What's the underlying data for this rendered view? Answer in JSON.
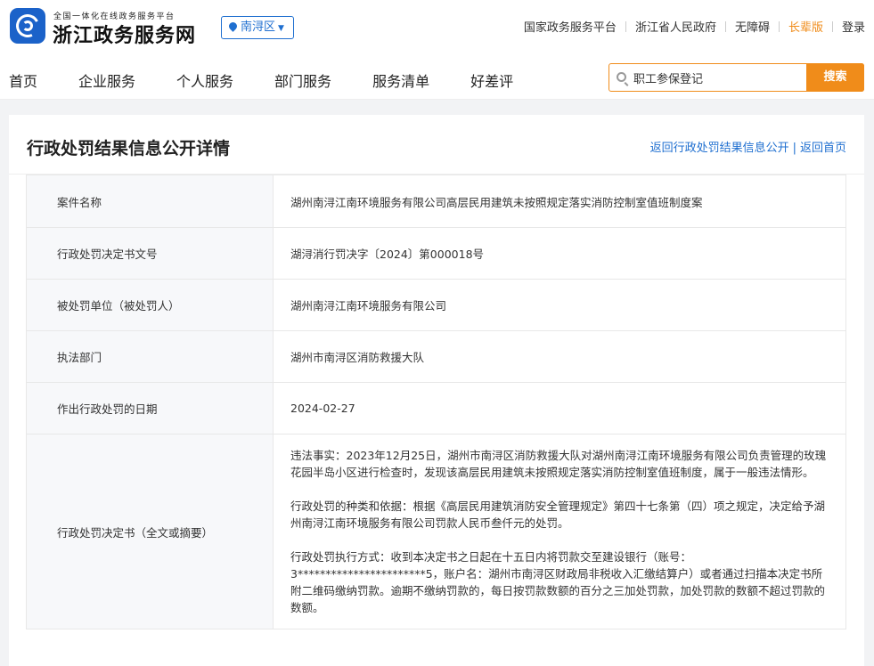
{
  "header": {
    "logo_sub": "全国一体化在线政务服务平台",
    "logo_main": "浙江政务服务网",
    "region": "南浔区",
    "links": [
      "国家政务服务平台",
      "浙江省人民政府",
      "无障碍",
      "长辈版",
      "登录"
    ]
  },
  "nav": {
    "items": [
      "首页",
      "企业服务",
      "个人服务",
      "部门服务",
      "服务清单",
      "好差评"
    ],
    "search_value": "职工参保登记",
    "search_button": "搜索"
  },
  "page": {
    "title": "行政处罚结果信息公开详情",
    "back_list": "返回行政处罚结果信息公开",
    "back_home": "返回首页"
  },
  "rows": [
    {
      "label": "案件名称",
      "value": "湖州南浔江南环境服务有限公司高层民用建筑未按照规定落实消防控制室值班制度案"
    },
    {
      "label": "行政处罚决定书文号",
      "value": "湖浔消行罚决字〔2024〕第000018号"
    },
    {
      "label": "被处罚单位（被处罚人）",
      "value": "湖州南浔江南环境服务有限公司"
    },
    {
      "label": "执法部门",
      "value": "湖州市南浔区消防救援大队"
    },
    {
      "label": "作出行政处罚的日期",
      "value": "2024-02-27"
    }
  ],
  "decision": {
    "label": "行政处罚决定书（全文或摘要）",
    "paragraphs": [
      "违法事实：2023年12月25日，湖州市南浔区消防救援大队对湖州南浔江南环境服务有限公司负责管理的玫瑰花园半岛小区进行检查时，发现该高层民用建筑未按照规定落实消防控制室值班制度，属于一般违法情形。",
      "行政处罚的种类和依据：根据《高层民用建筑消防安全管理规定》第四十七条第（四）项之规定，决定给予湖州南浔江南环境服务有限公司罚款人民币叁仟元的处罚。",
      "行政处罚执行方式：收到本决定书之日起在十五日内将罚款交至建设银行（账号：3***********************5，账户名：湖州市南浔区财政局非税收入汇缴结算户）或者通过扫描本决定书所附二维码缴纳罚款。逾期不缴纳罚款的，每日按罚款数额的百分之三加处罚款，加处罚款的数额不超过罚款的数额。"
    ]
  }
}
